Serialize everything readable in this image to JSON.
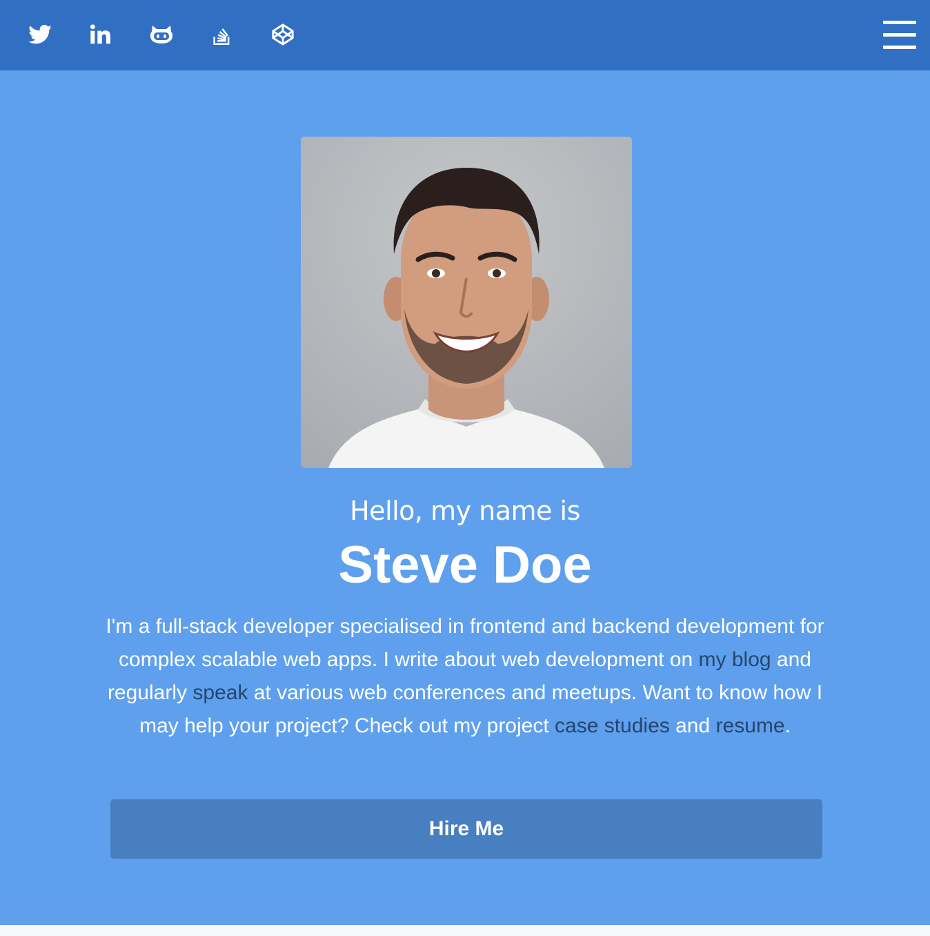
{
  "nav": {
    "social_links": [
      {
        "icon": "twitter-icon"
      },
      {
        "icon": "linkedin-icon"
      },
      {
        "icon": "github-icon"
      },
      {
        "icon": "stackoverflow-icon"
      },
      {
        "icon": "codepen-icon"
      }
    ],
    "menu_icon": "hamburger-menu-icon"
  },
  "hero": {
    "greeting": "Hello, my name is",
    "name": "Steve Doe",
    "bio": {
      "part1": "I'm a full-stack developer specialised in frontend and backend development for complex scalable web apps. I write about web development on ",
      "link_blog": "my blog",
      "part2": " and regularly ",
      "link_speak": "speak",
      "part3": " at various web conferences and meetups. Want to know how I may help your project? Check out my project ",
      "link_case_studies": "case studies",
      "part4": " and ",
      "link_resume": "resume",
      "part5": "."
    },
    "cta_label": "Hire Me",
    "profile_photo": "portrait of smiling man"
  },
  "colors": {
    "topbar": "#316fc2",
    "hero_bg": "#5ea0ed",
    "button_bg": "#477fc0",
    "link": "#26456e",
    "text": "#ffffff"
  }
}
